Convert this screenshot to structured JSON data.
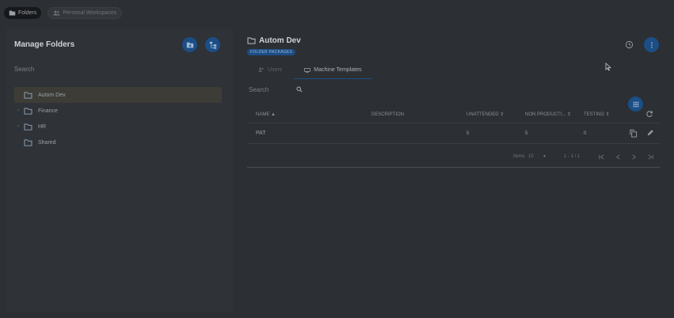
{
  "topbar": {
    "folders_label": "Folders",
    "personal_label": "Personal Workspaces"
  },
  "left": {
    "title": "Manage Folders",
    "search_label": "Search",
    "tree": [
      {
        "label": "Autom Dev",
        "selected": true,
        "expandable": false
      },
      {
        "label": "Finance",
        "selected": false,
        "expandable": true
      },
      {
        "label": "HR",
        "selected": false,
        "expandable": true
      },
      {
        "label": "Shared",
        "selected": false,
        "expandable": false
      }
    ]
  },
  "right": {
    "title": "Autom Dev",
    "badge": "FOLDER PACKAGES",
    "tabs": [
      {
        "label": "Users",
        "active": false
      },
      {
        "label": "Machine Templates",
        "active": true
      }
    ],
    "search_label": "Search",
    "table": {
      "headers": {
        "name": "NAME",
        "description": "DESCRIPTION",
        "unattended": "UNATTENDED",
        "nonproduction": "NON PRODUCTI...",
        "testing": "TESTING"
      },
      "rows": [
        {
          "name": "PAT",
          "description": "",
          "unattended": "5",
          "nonproduction": "5",
          "testing": "0"
        }
      ]
    },
    "pager": {
      "items_label": "Items",
      "page_size": "10",
      "range": "1 - 1 / 1"
    }
  },
  "icons": {
    "folder": "folder-icon",
    "add_folder": "add-folder-icon",
    "hierarchy": "hierarchy-icon",
    "users": "users-icon",
    "monitor": "monitor-icon",
    "search": "search-icon",
    "grid": "grid-icon",
    "refresh": "refresh-icon",
    "copy": "copy-icon",
    "edit": "edit-icon",
    "history": "history-icon",
    "more": "more-vert-icon"
  },
  "colors": {
    "accent": "#1c4e86",
    "background": "#2c2f33"
  }
}
